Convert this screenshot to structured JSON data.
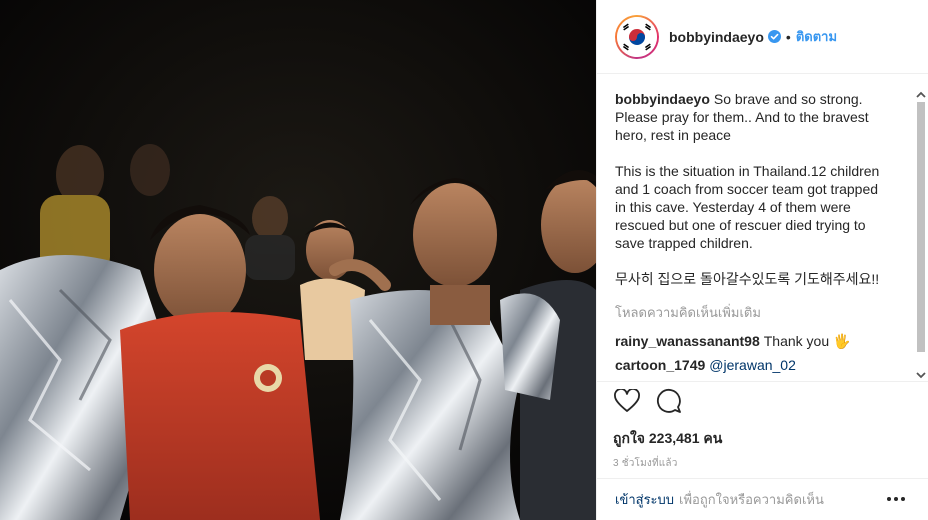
{
  "post": {
    "username": "bobbyindaeyo",
    "verified_icon": "verified-badge-icon",
    "dot": "•",
    "follow_label": "ติดตาม",
    "caption": {
      "username": "bobbyindaeyo",
      "line1": "So brave and so strong. Please pray for them.. And to the bravest hero, rest in peace",
      "line2": "This is the situation in Thailand.12 children and 1 coach from soccer team got trapped in this cave. Yesterday 4 of them were rescued but one of rescuer died trying to save trapped children.",
      "line3": "무사히 집으로 돌아갈수있도록 기도해주세요!!"
    },
    "load_more_comments": "โหลดความคิดเห็นเพิ่มเติม",
    "comments": [
      {
        "user": "rainy_wanassanant98",
        "text": "Thank you 🖐",
        "mention": ""
      },
      {
        "user": "cartoon_1749",
        "text": "",
        "mention": "@jerawan_02"
      }
    ],
    "likes_label": "ถูกใจ 223,481 คน",
    "timestamp": "3 ชั่วโมงที่แล้ว",
    "login_link": "เข้าสู่ระบบ",
    "login_hint": "เพื่อถูกใจหรือความคิดเห็น",
    "icons": {
      "like": "heart-icon",
      "comment": "comment-bubble-icon",
      "more": "more-options-icon",
      "scroll_up": "chevron-up-icon",
      "scroll_down": "chevron-down-icon"
    },
    "colors": {
      "link": "#3897f0",
      "text": "#262626",
      "muted": "#999999",
      "mention": "#003569"
    }
  }
}
